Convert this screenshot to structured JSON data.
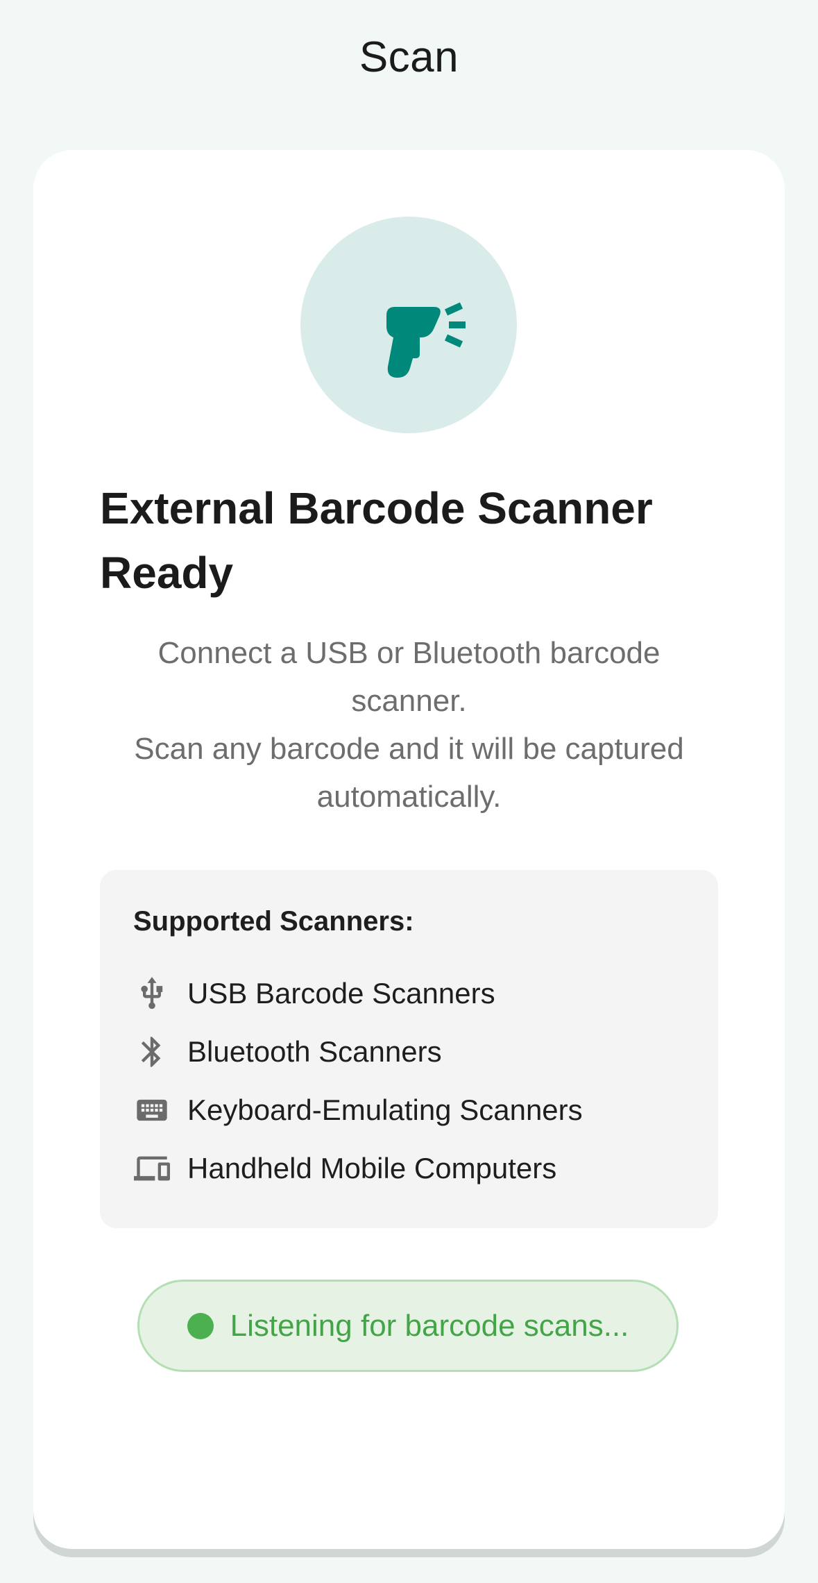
{
  "app_bar": {
    "title": "Scan"
  },
  "hero": {
    "icon": "barcode-scanner-icon",
    "circle_color": "#d9ecea",
    "icon_color": "#00897b"
  },
  "headline": "External Barcode Scanner Ready",
  "description": {
    "line1": "Connect a USB or Bluetooth barcode scanner.",
    "line2": "Scan any barcode and it will be captured automatically."
  },
  "supported": {
    "title": "Supported Scanners:",
    "items": [
      {
        "icon": "usb-icon",
        "label": "USB Barcode Scanners"
      },
      {
        "icon": "bluetooth-icon",
        "label": "Bluetooth Scanners"
      },
      {
        "icon": "keyboard-icon",
        "label": "Keyboard-Emulating Scanners"
      },
      {
        "icon": "devices-icon",
        "label": "Handheld Mobile Computers"
      }
    ]
  },
  "status": {
    "text": "Listening for barcode scans...",
    "dot_color": "#4caf50",
    "text_color": "#43a548"
  }
}
